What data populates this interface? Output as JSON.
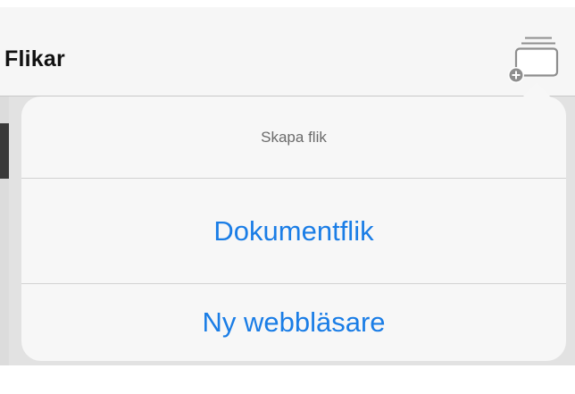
{
  "navbar": {
    "title": "Flikar",
    "new_tab_icon": "new-tab-icon"
  },
  "popover": {
    "header": "Skapa flik",
    "items": [
      {
        "label": "Dokumentflik"
      },
      {
        "label": "Ny webbläsare"
      }
    ]
  },
  "colors": {
    "accent": "#1a7de6",
    "navbar_bg": "#f6f6f6",
    "popover_bg": "#f7f7f7",
    "dimmed_bg": "#e2e2e2"
  }
}
